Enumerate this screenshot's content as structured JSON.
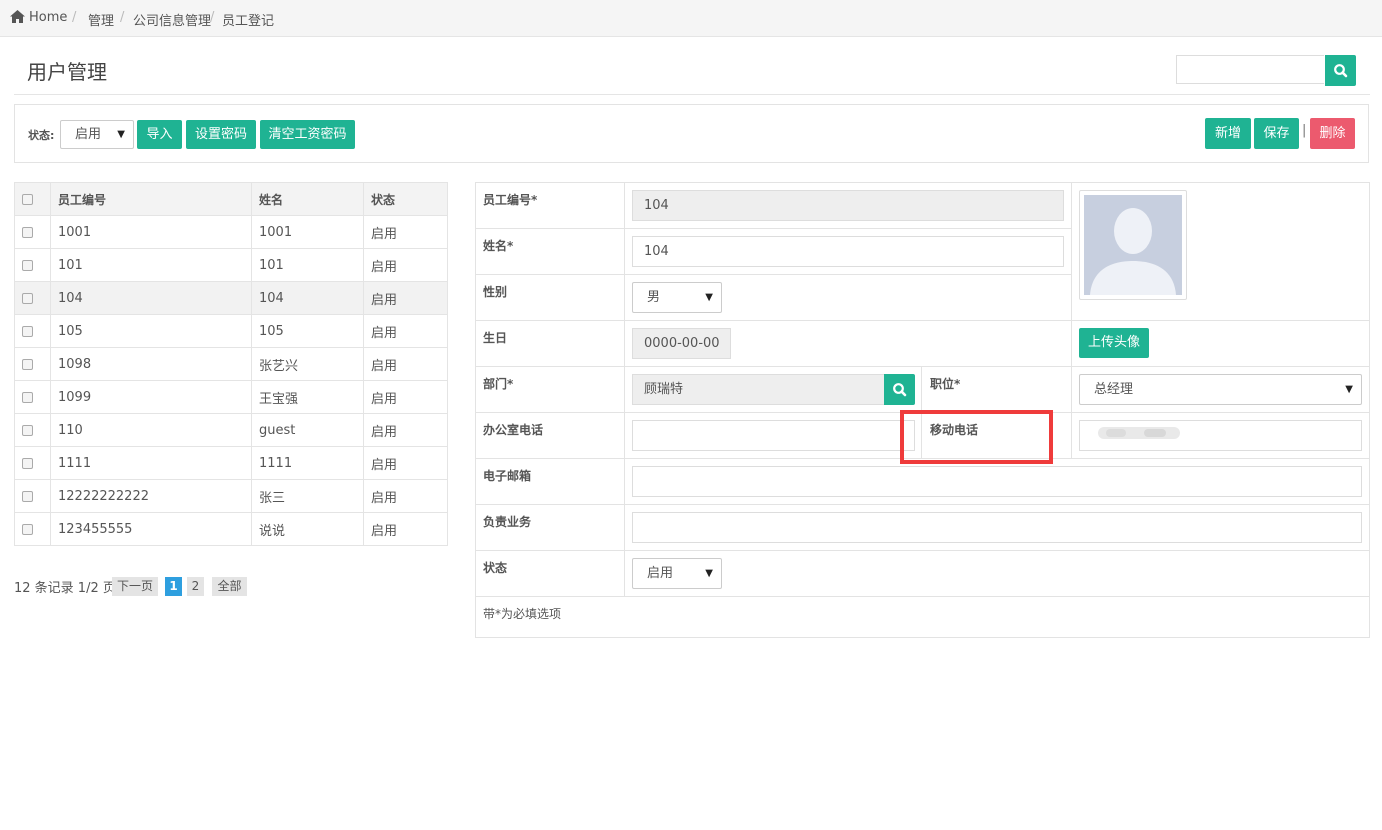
{
  "breadcrumb": {
    "home": "Home",
    "items": [
      "管理",
      "公司信息管理",
      "员工登记"
    ]
  },
  "page_title": "用户管理",
  "search": {
    "placeholder": ""
  },
  "toolbar": {
    "status_label": "状态:",
    "status_value": "启用",
    "import_label": "导入",
    "set_password_label": "设置密码",
    "clear_salary_password_label": "清空工资密码",
    "add_label": "新增",
    "save_label": "保存",
    "divider": "|",
    "delete_label": "删除"
  },
  "table": {
    "headers": [
      "员工编号",
      "姓名",
      "状态"
    ],
    "rows": [
      {
        "id": "1001",
        "name": "1001",
        "status": "启用"
      },
      {
        "id": "101",
        "name": "101",
        "status": "启用"
      },
      {
        "id": "104",
        "name": "104",
        "status": "启用"
      },
      {
        "id": "105",
        "name": "105",
        "status": "启用"
      },
      {
        "id": "1098",
        "name": "张艺兴",
        "status": "启用"
      },
      {
        "id": "1099",
        "name": "王宝强",
        "status": "启用"
      },
      {
        "id": "110",
        "name": "guest",
        "status": "启用"
      },
      {
        "id": "1111",
        "name": "1111",
        "status": "启用"
      },
      {
        "id": "12222222222",
        "name": "张三",
        "status": "启用"
      },
      {
        "id": "123455555",
        "name": "说说",
        "status": "启用"
      }
    ],
    "selected_index": 2
  },
  "pager": {
    "info": "12 条记录 1/2 页",
    "next": "下一页",
    "pages": [
      "1",
      "2"
    ],
    "all": "全部",
    "current": "1"
  },
  "form": {
    "emp_id_label": "员工编号*",
    "emp_id_value": "104",
    "name_label": "姓名*",
    "name_value": "104",
    "gender_label": "性别",
    "gender_value": "男",
    "birthday_label": "生日",
    "birthday_value": "0000-00-00",
    "upload_avatar_label": "上传头像",
    "dept_label": "部门*",
    "dept_value": "顾瑞特",
    "position_label": "职位*",
    "position_value": "总经理",
    "office_phone_label": "办公室电话",
    "office_phone_value": "",
    "mobile_label": "移动电话",
    "email_label": "电子邮箱",
    "email_value": "",
    "business_label": "负责业务",
    "business_value": "",
    "status_label": "状态",
    "status_value": "启用",
    "note": "带*为必填选项"
  },
  "colors": {
    "accent": "#1fb393",
    "danger": "#ec5a6e",
    "pager_active": "#2e9fdf",
    "highlight": "#ef3b3b"
  }
}
